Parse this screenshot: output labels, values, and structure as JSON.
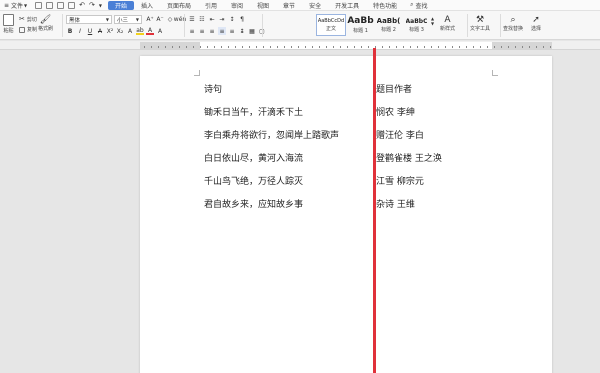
{
  "menubar": {
    "file_label": "文件",
    "tabs": [
      "开始",
      "插入",
      "页面布局",
      "引用",
      "审阅",
      "视图",
      "章节",
      "安全",
      "开发工具",
      "特色功能"
    ],
    "active_tab": "开始",
    "search_label": "查找"
  },
  "ribbon": {
    "paste_label": "粘贴",
    "cut_label": "剪切",
    "copy_label": "复制",
    "format_painter_label": "格式刷",
    "font_name": "黑体",
    "font_size": "小三",
    "styles": [
      {
        "sample": "AaBbCcDd",
        "name": "正文"
      },
      {
        "sample": "AaBb",
        "name": "标题 1"
      },
      {
        "sample": "AaBb(",
        "name": "标题 2"
      },
      {
        "sample": "AaBbC",
        "name": "标题 3"
      }
    ],
    "new_style_label": "新样式",
    "text_tools_label": "文字工具",
    "find_replace_label": "查找替换",
    "select_label": "选择"
  },
  "document": {
    "left_column": [
      "诗句",
      "锄禾日当午，汗滴禾下土",
      "李白乘舟将欲行，忽闻岸上踏歌声",
      "白日依山尽，黄河入海流",
      "千山鸟飞绝，万径人踪灭",
      "君自故乡来，应知故乡事"
    ],
    "right_column": [
      "题目作者",
      "悯农 李绅",
      "赠汪伦 李白",
      "登鹳雀楼 王之涣",
      "江雪 柳宗元",
      "杂诗 王维"
    ],
    "divider_color": "#e0313a"
  },
  "colors": {
    "accent": "#4a7fd6",
    "page_bg": "#ffffff",
    "workspace_bg": "#e6e6e6"
  }
}
